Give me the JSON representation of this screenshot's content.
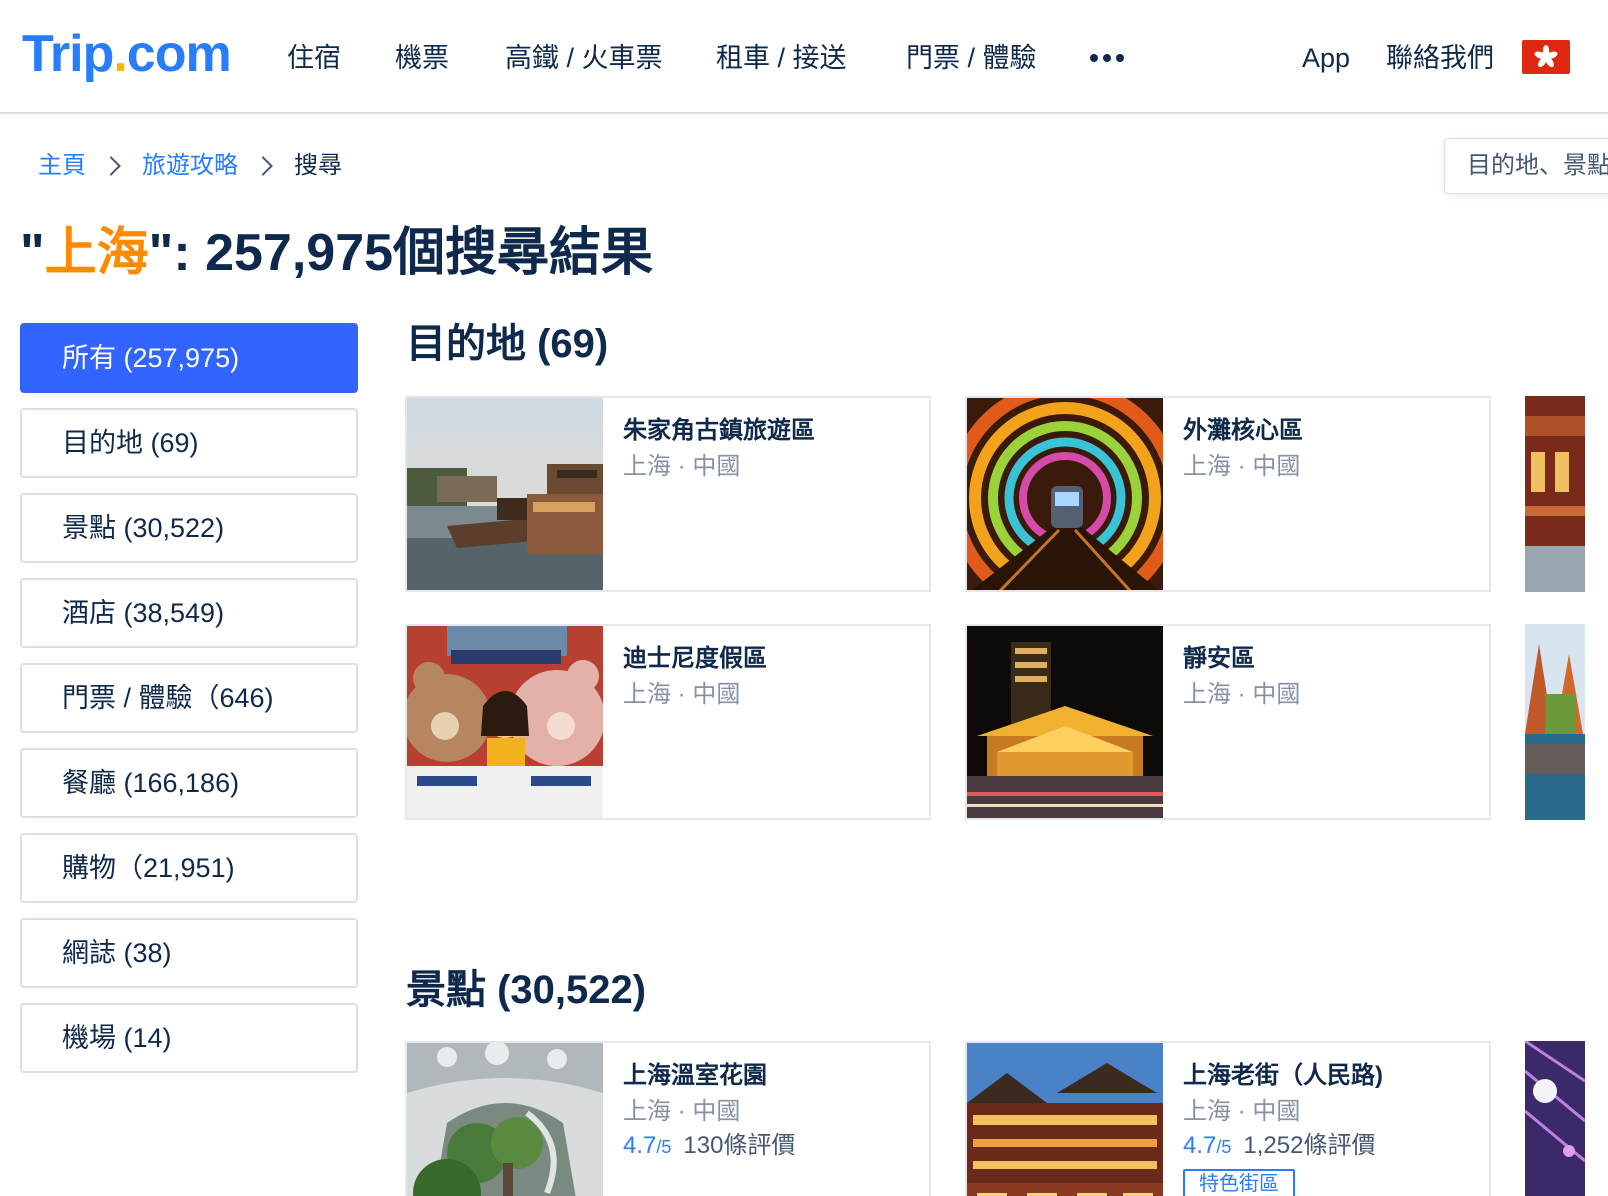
{
  "header": {
    "logo": {
      "main": "Trip",
      "dot": ".",
      "suffix": "com"
    },
    "nav": [
      "住宿",
      "機票",
      "高鐵 / 火車票",
      "租車 / 接送",
      "門票 / 體驗"
    ],
    "app_label": "App",
    "contact_label": "聯絡我們",
    "more_icon": "more-dots-icon",
    "flag_icon": "hk-flag-icon"
  },
  "breadcrumb": [
    "主頁",
    "旅遊攻略",
    "搜尋"
  ],
  "search": {
    "placeholder": "目的地、景點"
  },
  "results": {
    "quote_open": "\"",
    "keyword": "上海",
    "rest": "\": 257,975個搜尋結果"
  },
  "sidebar": {
    "items": [
      "所有 (257,975)",
      "目的地 (69)",
      "景點 (30,522)",
      "酒店 (38,549)",
      "門票 / 體驗（646)",
      "餐廳 (166,186)",
      "購物（21,951)",
      "網誌 (38)",
      "機場 (14)"
    ]
  },
  "destinations": {
    "title": "目的地 (69)",
    "cards": [
      {
        "name": "朱家角古鎮旅遊區",
        "location": "上海 · 中國"
      },
      {
        "name": "外灘核心區",
        "location": "上海 · 中國"
      },
      {
        "name": "迪士尼度假區",
        "location": "上海 · 中國"
      },
      {
        "name": "靜安區",
        "location": "上海 · 中國"
      }
    ]
  },
  "attractions": {
    "title": "景點 (30,522)",
    "cards": [
      {
        "name": "上海溫室花園",
        "location": "上海 · 中國",
        "score": "4.7",
        "max": "/5",
        "reviews": "130條評價"
      },
      {
        "name": "上海老街（人民路)",
        "location": "上海 · 中國",
        "score": "4.7",
        "max": "/5",
        "reviews": "1,252條評價",
        "tag": "特色街區"
      }
    ]
  },
  "colors": {
    "brand": "#287dfa",
    "accent_orange": "#ff8a00",
    "active_tab": "#3264ff",
    "text": "#0f294d"
  }
}
